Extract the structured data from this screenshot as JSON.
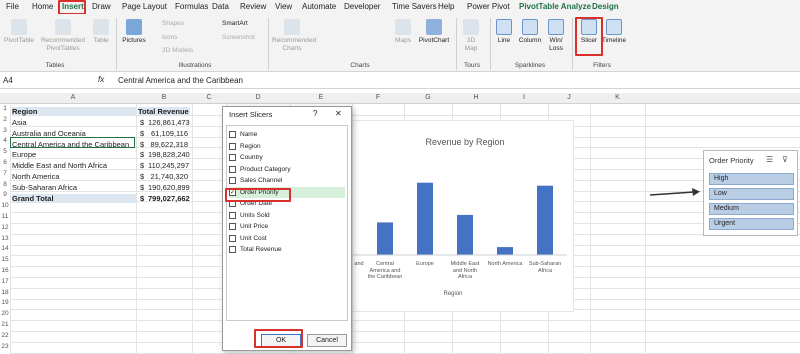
{
  "ribbon_tabs": [
    "File",
    "Home",
    "Insert",
    "Draw",
    "Page Layout",
    "Formulas",
    "Data",
    "Review",
    "View",
    "Automate",
    "Developer",
    "Time Savers",
    "Help",
    "Power Pivot",
    "PivotTable Analyze",
    "Design"
  ],
  "ribbon": {
    "pivottable": "PivotTable",
    "recommended_pivottables": "Recommended PivotTables",
    "table": "Table",
    "pictures": "Pictures",
    "shapes": "Shapes",
    "icons": "Icons",
    "models_3d": "3D Models",
    "smartart": "SmartArt",
    "screenshot": "Screenshot",
    "recommended_charts": "Recommended Charts",
    "maps": "Maps",
    "pivotchart": "PivotChart",
    "map_3d": "3D Map",
    "line": "Line",
    "column": "Column",
    "winloss": "Win/ Loss",
    "slicer": "Slicer",
    "timeline": "Timeline",
    "groups": {
      "tables": "Tables",
      "illustrations": "Illustrations",
      "charts": "Charts",
      "tours": "Tours",
      "sparklines": "Sparklines",
      "filters": "Filters"
    }
  },
  "formula_bar": {
    "name_box": "A4",
    "fx": "fx",
    "content": "Central America and the Caribbean"
  },
  "columns": [
    "A",
    "B",
    "C",
    "D",
    "E",
    "F",
    "G",
    "H",
    "I",
    "J",
    "K"
  ],
  "rows": [
    "1",
    "2",
    "3",
    "4",
    "5",
    "6",
    "7",
    "8",
    "9",
    "10",
    "11",
    "12",
    "13",
    "14",
    "15",
    "16",
    "17",
    "18",
    "19",
    "20",
    "21",
    "22",
    "23"
  ],
  "table": {
    "header_region": "Region",
    "header_revenue": "Total Revenue",
    "rows": [
      {
        "region": "Asia",
        "currency": "$",
        "value": "126,861,473"
      },
      {
        "region": "Australia and Oceania",
        "currency": "$",
        "value": "61,109,116"
      },
      {
        "region": "Central America and the Caribbean",
        "currency": "$",
        "value": "89,622,318"
      },
      {
        "region": "Europe",
        "currency": "$",
        "value": "198,828,240"
      },
      {
        "region": "Middle East and North Africa",
        "currency": "$",
        "value": "110,245,297"
      },
      {
        "region": "North America",
        "currency": "$",
        "value": "21,740,320"
      },
      {
        "region": "Sub-Saharan Africa",
        "currency": "$",
        "value": "190,620,899"
      }
    ],
    "grand_total_label": "Grand Total",
    "grand_total_currency": "$",
    "grand_total_value": "799,027,662"
  },
  "dialog": {
    "title": "Insert Slicers",
    "help": "?",
    "close": "✕",
    "fields": [
      {
        "label": "Name",
        "checked": false
      },
      {
        "label": "Region",
        "checked": false
      },
      {
        "label": "Country",
        "checked": false
      },
      {
        "label": "Product Category",
        "checked": false
      },
      {
        "label": "Sales Channel",
        "checked": false
      },
      {
        "label": "Order Priority",
        "checked": true
      },
      {
        "label": "Order Date",
        "checked": false
      },
      {
        "label": "Units Sold",
        "checked": false
      },
      {
        "label": "Unit Price",
        "checked": false
      },
      {
        "label": "Unit Cost",
        "checked": false
      },
      {
        "label": "Total Revenue",
        "checked": false
      }
    ],
    "ok": "OK",
    "cancel": "Cancel"
  },
  "chart_data": {
    "type": "bar",
    "title": "Revenue by Region",
    "xlabel": "Region",
    "categories": [
      "Asia",
      "Australia and Oceania",
      "Central America and the Caribbean",
      "Europe",
      "Middle East and North Africa",
      "North America",
      "Sub-Saharan Africa"
    ],
    "visible_labels": [
      "and",
      "Central America and the Caribbean",
      "Europe",
      "Middle East and North Africa",
      "North America",
      "Sub-Saharan Africa"
    ],
    "values": [
      126861473,
      61109116,
      89622318,
      198828240,
      110245297,
      21740320,
      190620899
    ],
    "ylim": [
      0,
      220000000
    ],
    "color": "#4472c4"
  },
  "slicer": {
    "title": "Order Priority",
    "items": [
      "High",
      "Low",
      "Medium",
      "Urgent"
    ]
  },
  "colors": {
    "accent_green": "#1e7145",
    "highlight_red": "#d9302c",
    "bar_blue": "#4472c4",
    "slicer_item": "#b9cde5"
  }
}
